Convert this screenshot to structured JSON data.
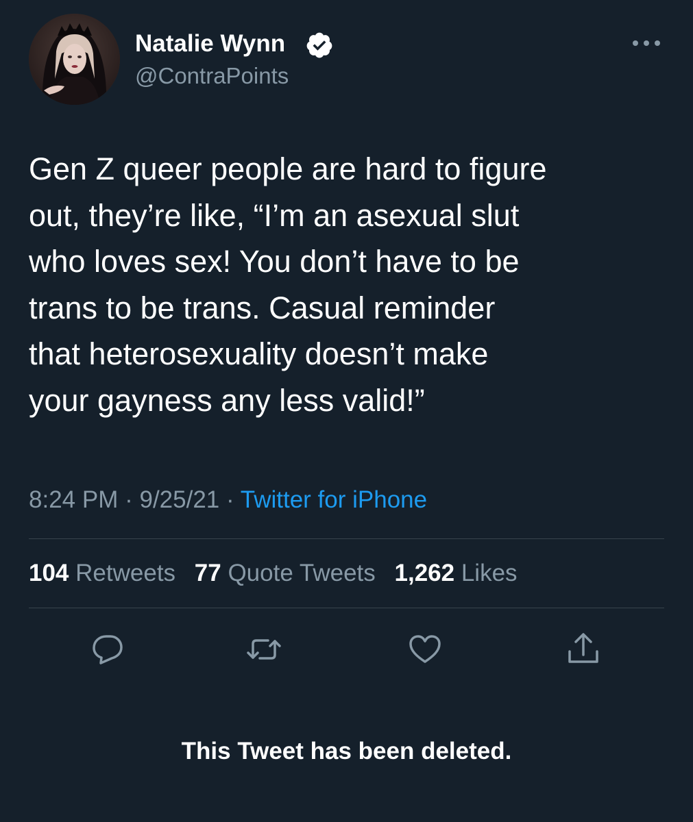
{
  "author": {
    "display_name": "Natalie Wynn",
    "handle": "@ContraPoints",
    "verified": true,
    "avatar_icon": "profile-photo"
  },
  "menu": {
    "more_icon": "more-horizontal-icon"
  },
  "tweet": {
    "lines": [
      "Gen Z queer people are hard to figure",
      "out, they’re like, “I’m an asexual slut",
      "who loves sex! You don’t have to be",
      "trans to be trans. Casual reminder",
      "that heterosexuality doesn’t make",
      "your gayness any less valid!”"
    ],
    "time": "8:24 PM",
    "separator": "·",
    "date": "9/25/21",
    "source": "Twitter for iPhone"
  },
  "stats": {
    "retweets_count": "104",
    "retweets_label": "Retweets",
    "quotes_count": "77",
    "quotes_label": "Quote Tweets",
    "likes_count": "1,262",
    "likes_label": "Likes"
  },
  "actions": {
    "reply_icon": "reply-icon",
    "retweet_icon": "retweet-icon",
    "like_icon": "heart-icon",
    "share_icon": "share-icon"
  },
  "notice": {
    "deleted_text": "This Tweet has been deleted."
  },
  "colors": {
    "background": "#15202b",
    "text_primary": "#ffffff",
    "text_secondary": "#8899a6",
    "accent": "#1d9bf0",
    "divider": "#38444d"
  }
}
